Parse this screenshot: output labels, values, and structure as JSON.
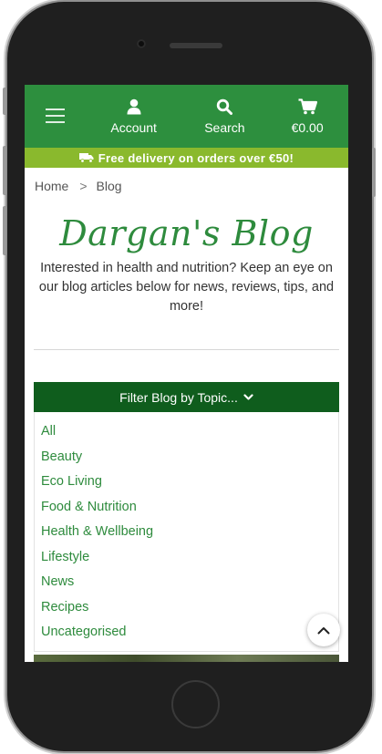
{
  "header": {
    "menu_icon": "hamburger-menu-icon",
    "account_label": "Account",
    "search_label": "Search",
    "cart_total": "€0.00"
  },
  "promo": {
    "text": "Free delivery on orders over €50!",
    "icon": "truck-icon"
  },
  "breadcrumb": {
    "home": "Home",
    "separator": ">",
    "current": "Blog"
  },
  "page": {
    "title": "Dargan's Blog",
    "intro": "Interested in health and nutrition? Keep an eye on our blog articles below for news, reviews, tips, and more!"
  },
  "filter": {
    "label": "Filter Blog by Topic...",
    "options": [
      "All",
      "Beauty",
      "Eco Living",
      "Food & Nutrition",
      "Health & Wellbeing",
      "Lifestyle",
      "News",
      "Recipes",
      "Uncategorised"
    ]
  },
  "colors": {
    "header_green": "#2d8f3e",
    "promo_lime": "#8ab92d",
    "filter_dark_green": "#0f5d1d",
    "link_green": "#2e8b3d"
  }
}
